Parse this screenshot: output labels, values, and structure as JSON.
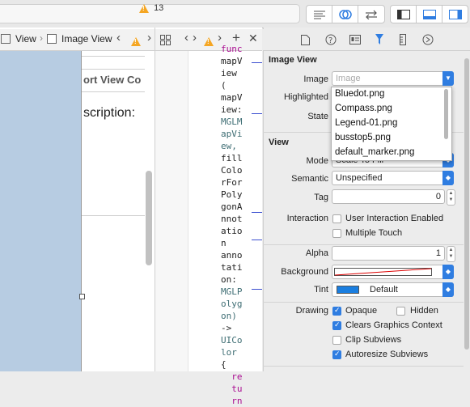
{
  "toolbar": {
    "warning_count": "13"
  },
  "left_tabs": {
    "view_label": "View",
    "image_view_label": "Image View"
  },
  "scene": {
    "title_fragment": "ort View Co",
    "description_fragment": "scription:"
  },
  "code": {
    "lines": [
      "func",
      "mapV",
      "iew",
      "(",
      "mapV",
      "iew:",
      "MGLM",
      "apVi",
      "ew,",
      "fill",
      "Colo",
      "rFor",
      "Poly",
      "gonA",
      "nnot",
      "atio",
      "n",
      "anno",
      "tati",
      "on:",
      "MGLP",
      "olyg",
      "on)",
      "->",
      "UICo",
      "lor",
      "{",
      "",
      "  re",
      "  tu",
      "  rn"
    ]
  },
  "inspector": {
    "image_view_section": "Image View",
    "image_label": "Image",
    "image_placeholder": "Image",
    "highlighted_label": "Highlighted",
    "state_label": "State",
    "dropdown_items": [
      "Bluedot.png",
      "Compass.png",
      "Legend-01.png",
      "busstop5.png",
      "default_marker.png"
    ],
    "view_section": "View",
    "mode_label": "Mode",
    "mode_value": "Scale To Fill",
    "semantic_label": "Semantic",
    "semantic_value": "Unspecified",
    "tag_label": "Tag",
    "tag_value": "0",
    "interaction_label": "Interaction",
    "user_interaction_label": "User Interaction Enabled",
    "multiple_touch_label": "Multiple Touch",
    "alpha_label": "Alpha",
    "alpha_value": "1",
    "background_label": "Background",
    "tint_label": "Tint",
    "tint_value": "Default",
    "drawing_label": "Drawing",
    "opaque_label": "Opaque",
    "hidden_label": "Hidden",
    "clears_label": "Clears Graphics Context",
    "clip_label": "Clip Subviews",
    "autoresize_label": "Autoresize Subviews"
  },
  "colors": {
    "accent": "#2f7de1",
    "canvas_blue": "#b7cce2",
    "tint_swatch": "#1a7ee0"
  }
}
